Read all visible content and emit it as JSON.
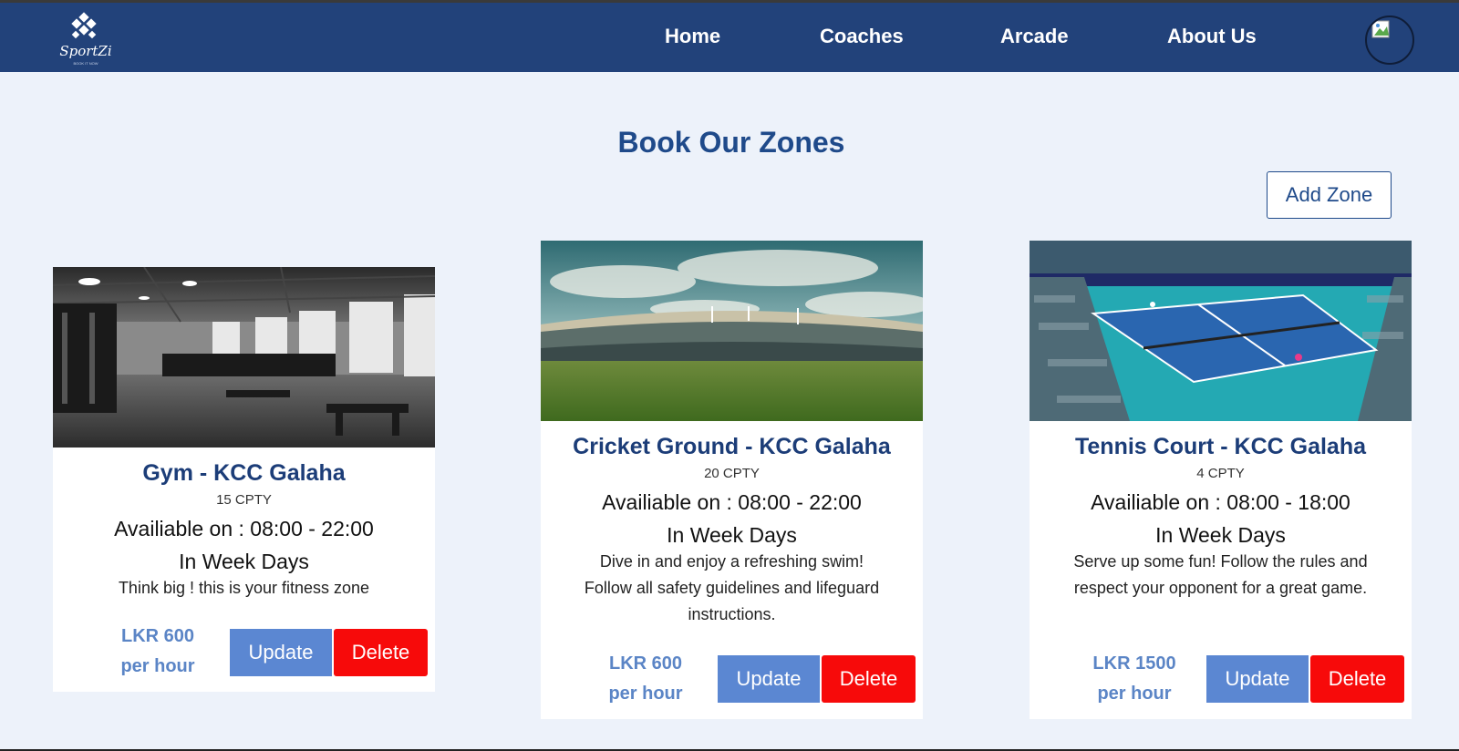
{
  "brand": {
    "name": "SportZi",
    "tagline": "BOOK IT NOW"
  },
  "nav": [
    {
      "label": "Home"
    },
    {
      "label": "Coaches"
    },
    {
      "label": "Arcade"
    },
    {
      "label": "About Us"
    }
  ],
  "page": {
    "title": "Book Our Zones",
    "add_zone_label": "Add Zone"
  },
  "zones": [
    {
      "title": "Gym - KCC Galaha",
      "capacity": "15 CPTY",
      "availability": "Availiable on : 08:00 - 22:00",
      "days": "In Week Days",
      "description": "Think big ! this is your fitness zone",
      "price_amount": "LKR 600",
      "price_unit": "per hour",
      "update_label": "Update",
      "delete_label": "Delete",
      "image_icon": "gym-interior-image"
    },
    {
      "title": "Cricket Ground - KCC Galaha",
      "capacity": "20 CPTY",
      "availability": "Availiable on : 08:00 - 22:00",
      "days": "In Week Days",
      "description": "Dive in and enjoy a refreshing swim! Follow all safety guidelines and lifeguard instructions.",
      "price_amount": "LKR 600",
      "price_unit": "per hour",
      "update_label": "Update",
      "delete_label": "Delete",
      "image_icon": "cricket-stadium-image"
    },
    {
      "title": "Tennis Court - KCC Galaha",
      "capacity": "4 CPTY",
      "availability": "Availiable on : 08:00 - 18:00",
      "days": "In Week Days",
      "description": "Serve up some fun! Follow the rules and respect your opponent for a great game.",
      "price_amount": "LKR 1500",
      "price_unit": "per hour",
      "update_label": "Update",
      "delete_label": "Delete",
      "image_icon": "tennis-court-image"
    }
  ],
  "colors": {
    "navbar": "#22427a",
    "background": "#edf2fa",
    "title": "#1f4a8a",
    "update": "#5b87d2",
    "delete": "#f70a0a",
    "price": "#5b85c6"
  }
}
